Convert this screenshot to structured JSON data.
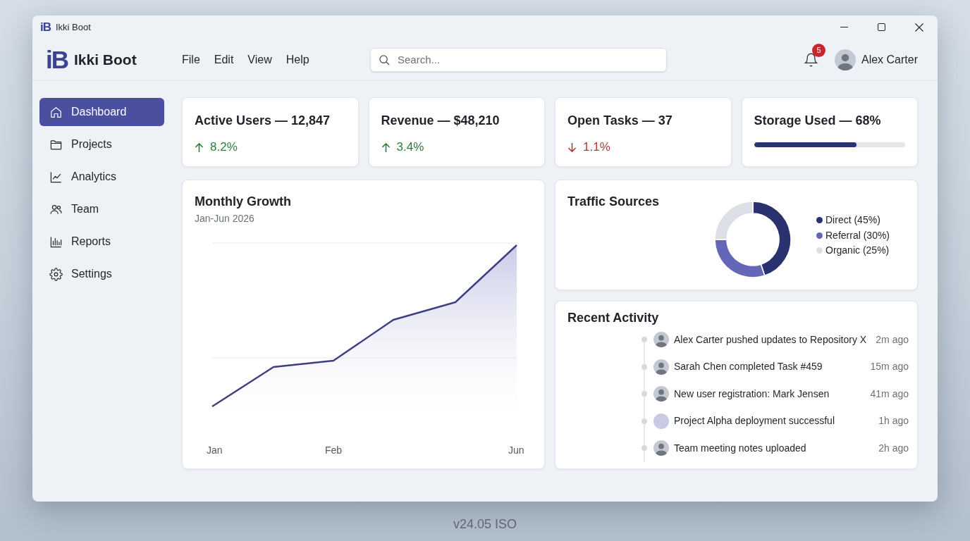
{
  "window": {
    "logo_mark": "iB",
    "title": "Ikki Boot"
  },
  "header": {
    "logo_mark": "iB",
    "app_name": "Ikki Boot",
    "menu": [
      "File",
      "Edit",
      "View",
      "Help"
    ],
    "search": {
      "placeholder": "Search..."
    },
    "notifications": {
      "count": "5"
    },
    "user": {
      "name": "Alex Carter"
    }
  },
  "sidebar": {
    "items": [
      {
        "label": "Dashboard",
        "selected": true
      },
      {
        "label": "Projects",
        "selected": false
      },
      {
        "label": "Analytics",
        "selected": false
      },
      {
        "label": "Team",
        "selected": false
      },
      {
        "label": "Reports",
        "selected": false
      },
      {
        "label": "Settings",
        "selected": false
      }
    ]
  },
  "stats": [
    {
      "kind": "change",
      "title": "Active Users — 12,847",
      "increase": true,
      "change": "8.2%"
    },
    {
      "kind": "change",
      "title": "Revenue — $48,210",
      "increase": true,
      "change": "3.4%"
    },
    {
      "kind": "change",
      "title": "Open Tasks — 37",
      "increase": false,
      "change": "1.1%"
    },
    {
      "kind": "progress",
      "title": "Storage Used — 68%",
      "level": 0.68
    }
  ],
  "growth_chart": {
    "title": "Monthly Growth",
    "subtitle": "Jan-Jun 2026",
    "x_labels": [
      "Jan",
      "Feb",
      "Jun"
    ]
  },
  "traffic_sources": {
    "title": "Traffic Sources",
    "chart_data": {
      "type": "donut",
      "values": [
        45,
        30,
        25
      ]
    },
    "legend": [
      {
        "label": "Direct (45%)",
        "color": "#29316f"
      },
      {
        "label": "Referral (30%)",
        "color": "#6466b8"
      },
      {
        "label": "Organic (25%)",
        "color": "#dcdfe6"
      }
    ]
  },
  "recent_activity": {
    "title": "Recent Activity",
    "items": [
      {
        "kind": "person",
        "text": "Alex Carter pushed updates to Repository X",
        "time": "2m ago"
      },
      {
        "kind": "person",
        "text": "Sarah Chen completed Task #459",
        "time": "15m ago"
      },
      {
        "kind": "person",
        "text": "New user registration: Mark Jensen",
        "time": "41m ago"
      },
      {
        "kind": "placeholder",
        "text": "Project Alpha deployment successful",
        "time": "1h ago"
      },
      {
        "kind": "person",
        "text": "Team meeting notes uploaded",
        "time": "2h ago"
      }
    ]
  },
  "version_label": "v24.05 ISO"
}
